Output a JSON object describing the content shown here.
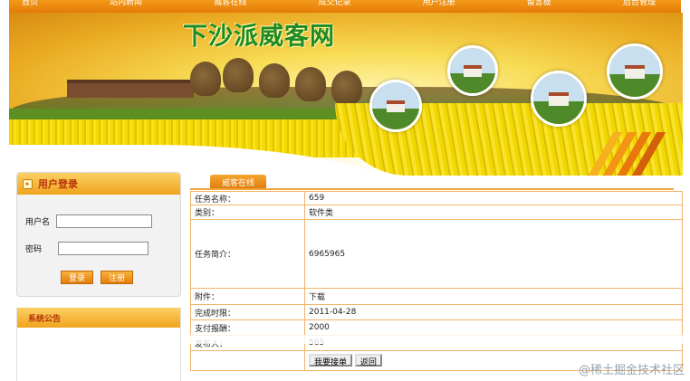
{
  "nav": {
    "items": [
      "首页",
      "站内新闻",
      "威客在线",
      "成交记录",
      "用户注册",
      "留言板",
      "后台管理"
    ]
  },
  "banner": {
    "title": "下沙派威客网"
  },
  "login": {
    "title": "用户登录",
    "username_label": "用户名",
    "password_label": "密码",
    "login_button": "登录",
    "register_button": "注册"
  },
  "notice": {
    "title": "系统公告"
  },
  "main": {
    "tab_label": "威客在线",
    "rows": [
      {
        "key": "任务名称：",
        "value": "659"
      },
      {
        "key": "类别：",
        "value": "软件类"
      },
      {
        "key": "任务简介：",
        "value": "6965965"
      },
      {
        "key": "附件：",
        "value": "下载"
      },
      {
        "key": "完成时限：",
        "value": "2011-04-28"
      },
      {
        "key": "支付报酬：",
        "value": "2000"
      },
      {
        "key": "发布人：",
        "value": "565"
      }
    ],
    "accept_button": "我要接单",
    "back_button": "返回"
  },
  "watermark": "@稀土掘金技术社区",
  "colors": {
    "accent": "#f0a33a",
    "nav": "#e47a08",
    "title_green": "#1e8a24"
  }
}
